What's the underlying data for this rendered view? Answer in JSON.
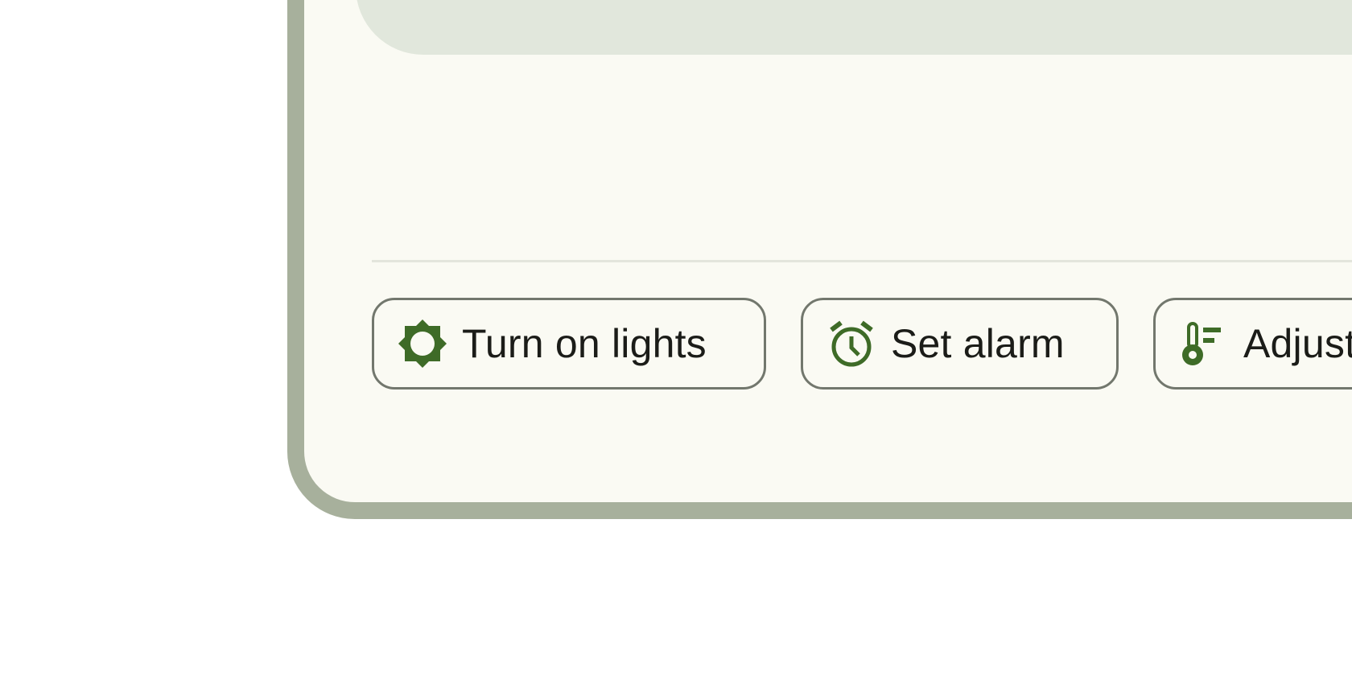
{
  "colors": {
    "frame": "#a7b09c",
    "surface": "#fafaf3",
    "top_panel": "#e1e7dc",
    "divider": "#e3e5dc",
    "chip_border": "#72776d",
    "icon": "#3e6b27",
    "text": "#1b1c18"
  },
  "suggestions": {
    "items": [
      {
        "label": "Turn on lights",
        "icon": "brightness-icon"
      },
      {
        "label": "Set alarm",
        "icon": "alarm-clock-icon"
      },
      {
        "label": "Adjust",
        "icon": "thermometer-icon"
      }
    ]
  }
}
